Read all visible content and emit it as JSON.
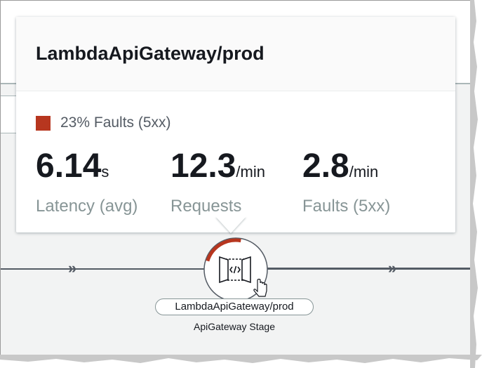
{
  "popover": {
    "title": "LambdaApiGateway/prod",
    "legend": {
      "label": "23% Faults (5xx)",
      "color": "#b7361f"
    },
    "metrics": [
      {
        "value": "6.14",
        "unit": "s",
        "label": "Latency (avg)"
      },
      {
        "value": "12.3",
        "unit": "/min",
        "label": "Requests"
      },
      {
        "value": "2.8",
        "unit": "/min",
        "label": "Faults (5xx)"
      }
    ]
  },
  "node": {
    "name": "LambdaApiGateway/prod",
    "type": "ApiGateway Stage",
    "icon": "api-gateway-icon",
    "fault_fraction": 0.23,
    "fault_color": "#b7361f"
  },
  "edges": {
    "arrow_glyph": "»"
  }
}
